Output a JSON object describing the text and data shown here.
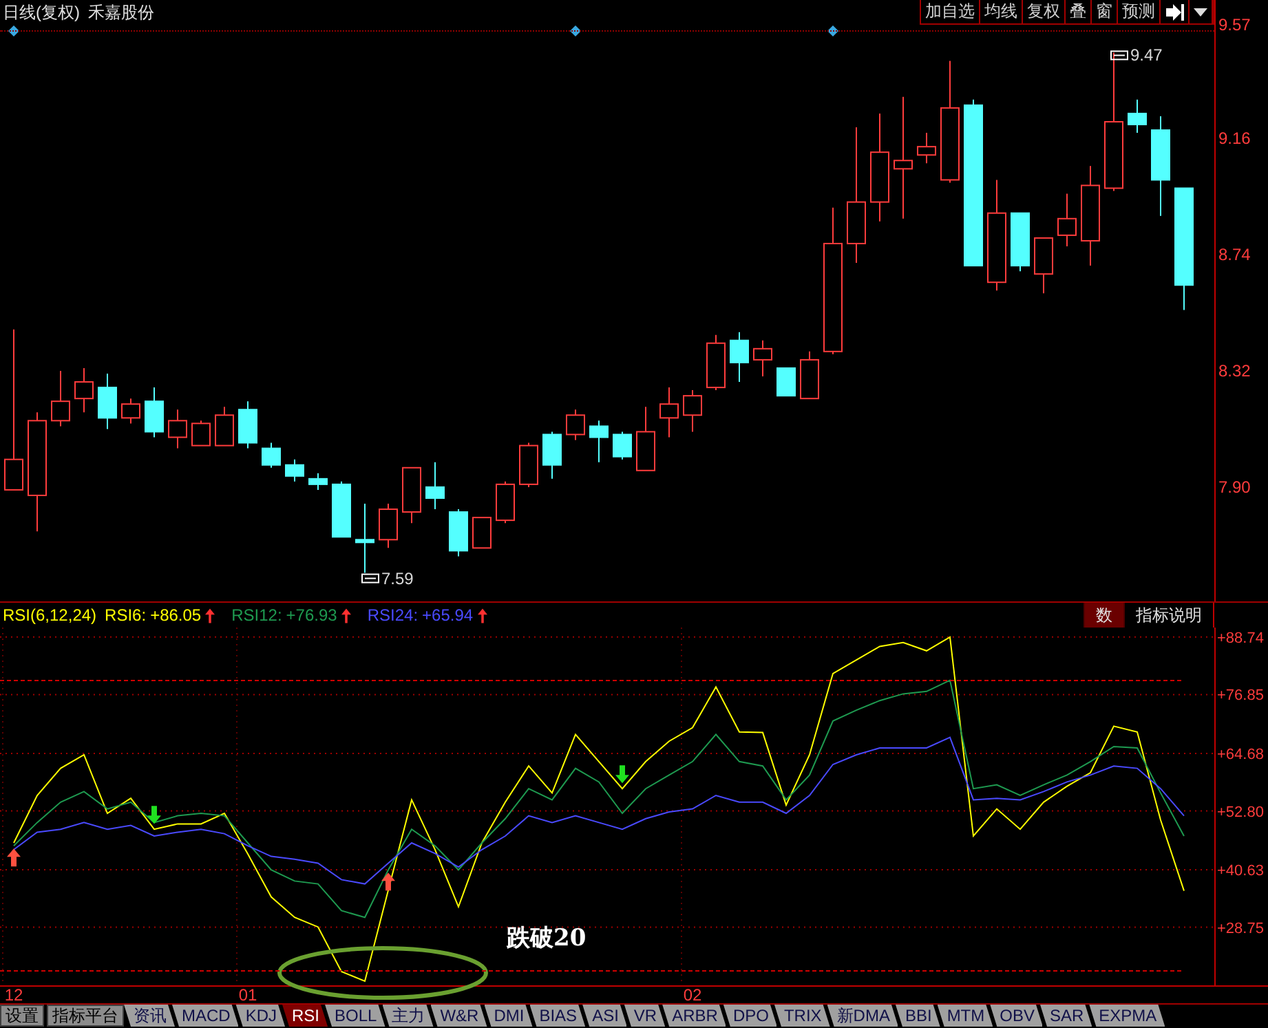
{
  "price_panel": {
    "period": "日线(复权)",
    "stock_name": "禾嘉股份",
    "toolbar": [
      {
        "kind": "text",
        "label": "加自选"
      },
      {
        "kind": "text",
        "label": "均线"
      },
      {
        "kind": "text",
        "label": "复权"
      },
      {
        "kind": "text",
        "label": "叠"
      },
      {
        "kind": "text",
        "label": "窗"
      },
      {
        "kind": "text",
        "label": "预测"
      },
      {
        "kind": "skip"
      },
      {
        "kind": "caret"
      }
    ],
    "chart_data": {
      "type": "candlestick",
      "ylim": [
        7.487,
        9.66
      ],
      "categories": [
        null,
        null,
        null,
        null,
        null,
        null,
        null,
        null,
        null,
        null,
        null,
        null,
        null,
        null,
        null,
        null,
        null,
        null,
        null,
        null,
        null,
        null,
        null,
        null,
        null,
        null,
        null,
        null,
        null,
        null,
        null,
        null,
        null,
        null,
        null,
        null,
        null,
        null,
        null,
        null,
        null,
        null,
        null,
        null,
        null,
        null,
        null,
        null,
        null,
        null,
        null
      ],
      "yticks": [
        {
          "value": 9.57,
          "label": "9.57"
        },
        {
          "value": 9.16,
          "label": "9.16"
        },
        {
          "value": 8.74,
          "label": "8.74"
        },
        {
          "value": 8.32,
          "label": "8.32"
        },
        {
          "value": 7.9,
          "label": "7.90"
        }
      ],
      "ohlc": [
        [
          7.89,
          8.47,
          7.89,
          8.0
        ],
        [
          7.87,
          8.17,
          7.74,
          8.14
        ],
        [
          8.14,
          8.32,
          8.12,
          8.21
        ],
        [
          8.22,
          8.33,
          8.17,
          8.28
        ],
        [
          8.26,
          8.31,
          8.11,
          8.15
        ],
        [
          8.15,
          8.22,
          8.13,
          8.2
        ],
        [
          8.21,
          8.26,
          8.08,
          8.1
        ],
        [
          8.08,
          8.18,
          8.04,
          8.14
        ],
        [
          8.05,
          8.14,
          8.05,
          8.13
        ],
        [
          8.05,
          8.19,
          8.05,
          8.16
        ],
        [
          8.18,
          8.21,
          8.04,
          8.06
        ],
        [
          8.04,
          8.06,
          7.97,
          7.98
        ],
        [
          7.98,
          8.0,
          7.92,
          7.94
        ],
        [
          7.93,
          7.95,
          7.89,
          7.91
        ],
        [
          7.91,
          7.92,
          7.72,
          7.72
        ],
        [
          7.71,
          7.84,
          7.59,
          7.7
        ],
        [
          7.71,
          7.84,
          7.68,
          7.82
        ],
        [
          7.81,
          7.97,
          7.77,
          7.97
        ],
        [
          7.9,
          7.99,
          7.82,
          7.86
        ],
        [
          7.81,
          7.82,
          7.65,
          7.67
        ],
        [
          7.68,
          7.79,
          7.68,
          7.79
        ],
        [
          7.78,
          7.92,
          7.77,
          7.91
        ],
        [
          7.91,
          8.06,
          7.9,
          8.05
        ],
        [
          8.09,
          8.1,
          7.93,
          7.98
        ],
        [
          8.09,
          8.18,
          8.07,
          8.16
        ],
        [
          8.12,
          8.14,
          7.99,
          8.08
        ],
        [
          8.09,
          8.1,
          8.0,
          8.01
        ],
        [
          7.96,
          8.19,
          7.96,
          8.1
        ],
        [
          8.15,
          8.26,
          8.08,
          8.2
        ],
        [
          8.16,
          8.25,
          8.1,
          8.23
        ],
        [
          8.26,
          8.45,
          8.25,
          8.42
        ],
        [
          8.43,
          8.46,
          8.28,
          8.35
        ],
        [
          8.36,
          8.43,
          8.3,
          8.4
        ],
        [
          8.33,
          8.33,
          8.23,
          8.23
        ],
        [
          8.22,
          8.39,
          8.22,
          8.36
        ],
        [
          8.39,
          8.91,
          8.38,
          8.78
        ],
        [
          8.78,
          9.2,
          8.71,
          8.93
        ],
        [
          8.93,
          9.25,
          8.86,
          9.11
        ],
        [
          9.05,
          9.31,
          8.87,
          9.08
        ],
        [
          9.1,
          9.18,
          9.07,
          9.13
        ],
        [
          9.01,
          9.44,
          9.0,
          9.27
        ],
        [
          9.28,
          9.3,
          8.7,
          8.7
        ],
        [
          8.64,
          9.01,
          8.61,
          8.89
        ],
        [
          8.89,
          8.89,
          8.68,
          8.7
        ],
        [
          8.67,
          8.8,
          8.6,
          8.8
        ],
        [
          8.81,
          8.96,
          8.77,
          8.87
        ],
        [
          8.79,
          9.06,
          8.7,
          8.99
        ],
        [
          8.98,
          9.47,
          8.97,
          9.22
        ],
        [
          9.25,
          9.3,
          9.18,
          9.21
        ],
        [
          9.19,
          9.24,
          8.88,
          9.01
        ],
        [
          8.98,
          8.98,
          8.54,
          8.63
        ]
      ],
      "annotations": [
        "9.47",
        "7.59"
      ]
    }
  },
  "rsi_panel": {
    "title": "RSI(6,12,24)",
    "legend": [
      "+86.05",
      "+76.93",
      "+65.94"
    ],
    "buttons": [
      {
        "label": "数",
        "selected": true
      },
      {
        "label": "指标说明",
        "selected": false
      }
    ],
    "chart_data": {
      "type": "line",
      "ylim": [
        16.75,
        90.7
      ],
      "grid": true,
      "categories": [
        "12",
        null,
        null,
        null,
        null,
        null,
        null,
        null,
        null,
        null,
        "01",
        null,
        null,
        null,
        null,
        null,
        null,
        null,
        null,
        null,
        null,
        null,
        null,
        null,
        null,
        null,
        null,
        null,
        null,
        "02",
        null,
        null,
        null,
        null,
        null,
        null,
        null,
        null,
        null,
        null,
        null,
        null,
        null,
        null,
        null,
        null,
        null,
        null,
        null,
        null,
        null
      ],
      "yticks": [
        {
          "value": 88.74,
          "label": "+88.74"
        },
        {
          "value": 76.85,
          "label": "+76.85"
        },
        {
          "value": 64.68,
          "label": "+64.68"
        },
        {
          "value": 52.8,
          "label": "+52.80"
        },
        {
          "value": 40.63,
          "label": "+40.63"
        },
        {
          "value": 28.75,
          "label": "+28.75"
        }
      ],
      "series": [
        {
          "name": "RSI6:",
          "color": "#ffff00",
          "values": [
            46.2,
            56.0,
            61.6,
            64.4,
            52.3,
            55.4,
            49.0,
            50.1,
            50.1,
            52.3,
            43.9,
            35.0,
            30.8,
            28.8,
            19.6,
            17.6,
            36.4,
            55.1,
            44.8,
            33.0,
            46.2,
            54.6,
            62.1,
            56.5,
            68.6,
            63.0,
            57.4,
            63.0,
            67.2,
            70.0,
            78.4,
            69.1,
            69.0,
            54.0,
            64.4,
            81.2,
            84.0,
            86.8,
            87.6,
            85.9,
            88.7,
            47.6,
            53.2,
            49.0,
            54.6,
            57.9,
            60.7,
            70.3,
            69.1,
            50.9,
            36.3
          ]
        },
        {
          "name": "RSI12:",
          "color": "#1e9a50",
          "values": [
            45.6,
            50.4,
            54.6,
            56.8,
            53.2,
            54.6,
            50.4,
            51.8,
            52.3,
            51.8,
            46.2,
            40.6,
            38.3,
            37.7,
            32.2,
            30.8,
            40.6,
            49.0,
            45.6,
            40.6,
            46.2,
            51.2,
            57.4,
            55.1,
            61.6,
            58.8,
            52.3,
            57.4,
            60.2,
            63.0,
            68.6,
            63.0,
            62.1,
            55.1,
            60.2,
            71.4,
            73.6,
            75.6,
            77.0,
            77.5,
            79.8,
            57.4,
            58.2,
            56.0,
            58.2,
            60.2,
            63.0,
            66.1,
            65.8,
            56.5,
            47.6
          ]
        },
        {
          "name": "RSI24:",
          "color": "#4a4aff",
          "values": [
            44.8,
            48.4,
            49.0,
            50.4,
            49.0,
            49.8,
            47.6,
            48.4,
            49.0,
            48.1,
            45.6,
            43.4,
            42.8,
            42.0,
            38.6,
            37.7,
            42.0,
            46.2,
            44.0,
            41.2,
            44.8,
            47.6,
            51.8,
            50.4,
            51.8,
            50.4,
            49.0,
            51.2,
            52.6,
            53.2,
            56.0,
            54.6,
            54.6,
            52.3,
            56.0,
            62.4,
            64.4,
            65.8,
            65.8,
            65.8,
            68.0,
            55.1,
            55.4,
            55.1,
            56.8,
            58.8,
            60.2,
            62.1,
            61.6,
            57.4,
            51.8
          ]
        }
      ],
      "annotations": [
        "跌破20"
      ]
    }
  },
  "tabs": [
    {
      "kind": "button",
      "label": "设置",
      "selected": false
    },
    {
      "kind": "button",
      "label": "指标平台",
      "selected": false
    },
    {
      "kind": "tab",
      "label": "资讯",
      "selected": false
    },
    {
      "kind": "tab",
      "label": "MACD",
      "selected": false
    },
    {
      "kind": "tab",
      "label": "KDJ",
      "selected": false
    },
    {
      "kind": "tab",
      "label": "RSI",
      "selected": true
    },
    {
      "kind": "tab",
      "label": "BOLL",
      "selected": false
    },
    {
      "kind": "tab",
      "label": "主力",
      "selected": false
    },
    {
      "kind": "tab",
      "label": "W&R",
      "selected": false
    },
    {
      "kind": "tab",
      "label": "DMI",
      "selected": false
    },
    {
      "kind": "tab",
      "label": "BIAS",
      "selected": false
    },
    {
      "kind": "tab",
      "label": "ASI",
      "selected": false
    },
    {
      "kind": "tab",
      "label": "VR",
      "selected": false
    },
    {
      "kind": "tab",
      "label": "ARBR",
      "selected": false
    },
    {
      "kind": "tab",
      "label": "DPO",
      "selected": false
    },
    {
      "kind": "tab",
      "label": "TRIX",
      "selected": false
    },
    {
      "kind": "tab",
      "label": "新DMA",
      "selected": false
    },
    {
      "kind": "tab",
      "label": "BBI",
      "selected": false
    },
    {
      "kind": "tab",
      "label": "MTM",
      "selected": false
    },
    {
      "kind": "tab",
      "label": "OBV",
      "selected": false
    },
    {
      "kind": "tab",
      "label": "SAR",
      "selected": false
    },
    {
      "kind": "tab",
      "label": "EXPMA",
      "selected": false
    }
  ]
}
